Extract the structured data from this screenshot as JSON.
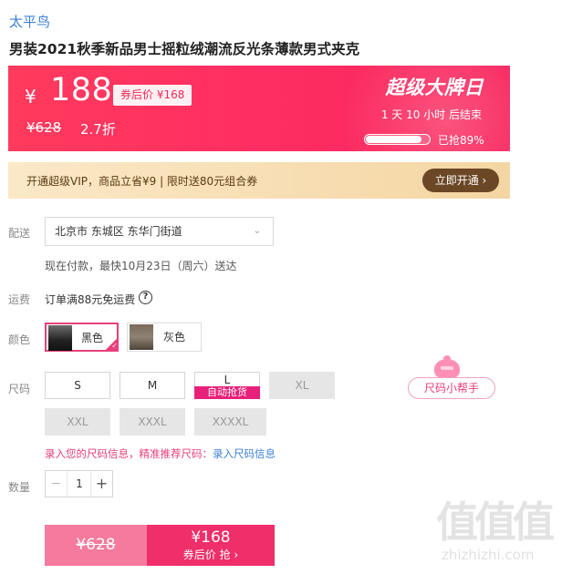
{
  "brand": "太平鸟",
  "product_title": "男装2021秋季新品男士摇粒绒潮流反光条薄款男式夹克",
  "price_banner": {
    "yen": "¥",
    "price": "188",
    "coupon_tag": "券后价 ¥168",
    "original_price": "¥628",
    "discount": "2.7折",
    "promo_title": "超级大牌日",
    "countdown": "1 天 10 小时 后结束",
    "grabbed_text": "已抢89%",
    "grabbed_fraction": 0.89
  },
  "vip": {
    "text": "开通超级VIP，商品立省¥9 | 限时送80元组合券",
    "button": "立即开通 ›"
  },
  "delivery": {
    "label": "配送",
    "address": "北京市 东城区 东华门街道",
    "estimate": "现在付款，最快10月23日（周六）送达"
  },
  "shipping": {
    "label": "运费",
    "text": "订单满88元免运费",
    "help_icon": "?"
  },
  "color": {
    "label": "颜色",
    "options": [
      {
        "name": "黑色",
        "selected": true
      },
      {
        "name": "灰色",
        "selected": false
      }
    ]
  },
  "size": {
    "label": "尺码",
    "options": [
      {
        "name": "S"
      },
      {
        "name": "M"
      },
      {
        "name": "L",
        "tag": "自动抢货"
      },
      {
        "name": "XL",
        "disabled": true
      },
      {
        "name": "XXL",
        "disabled": true
      },
      {
        "name": "XXXL",
        "disabled": true
      },
      {
        "name": "XXXXL",
        "disabled": true
      }
    ],
    "helper": "尺码小帮手",
    "tip": "录入您的尺码信息，精准推荐尺码：",
    "tip_link": "录入尺码信息"
  },
  "quantity": {
    "label": "数量",
    "minus": "−",
    "value": "1",
    "plus": "+"
  },
  "buy": {
    "original_price": "¥628",
    "coupon_price": "¥168",
    "coupon_label": "券后价 抢 ›"
  },
  "watermark": {
    "glyphs": "值值值",
    "url": "zhizhizhi.com"
  },
  "colors": {
    "accent": "#ef2e6a",
    "brand_link": "#3b7fd4",
    "vip_button": "#6b4726"
  }
}
